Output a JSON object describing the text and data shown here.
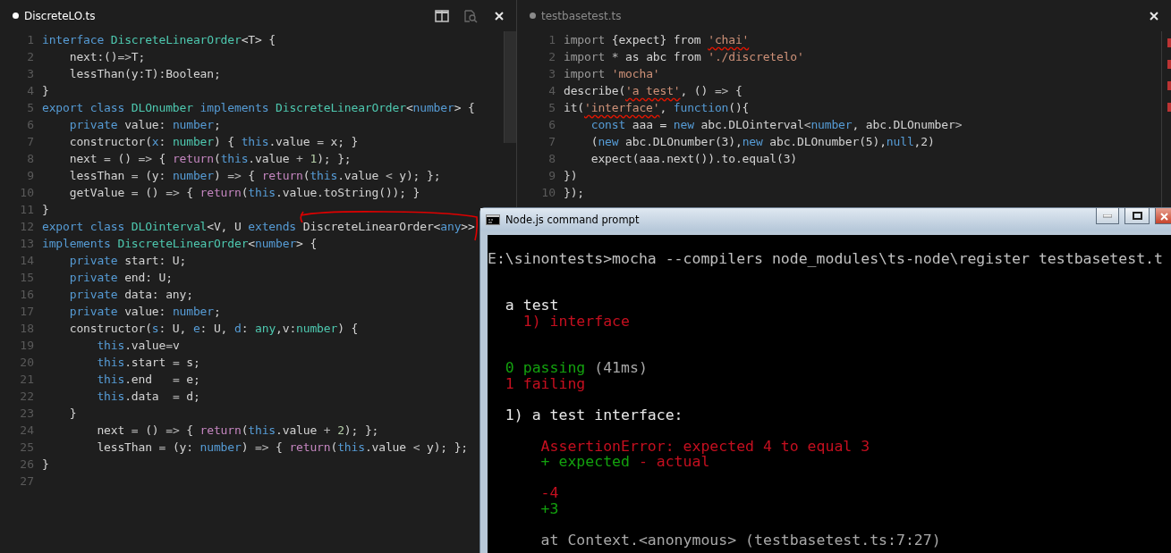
{
  "editors": [
    {
      "tab": {
        "title": "DiscreteLO.ts",
        "dirty": true,
        "active": true
      },
      "lines": [
        {
          "n": "1",
          "tokens": [
            {
              "kind": "kw",
              "text": "interface "
            },
            {
              "kind": "type",
              "text": "DiscreteLinearOrder"
            },
            {
              "kind": "txt",
              "text": "<T> {"
            }
          ]
        },
        {
          "n": "2",
          "tokens": [
            {
              "kind": "txt",
              "text": "    next:()"
            },
            {
              "kind": "op",
              "text": "=>"
            },
            {
              "kind": "txt",
              "text": "T;"
            }
          ]
        },
        {
          "n": "3",
          "tokens": [
            {
              "kind": "txt",
              "text": "    lessThan(y:T):Boolean;"
            }
          ]
        },
        {
          "n": "4",
          "tokens": [
            {
              "kind": "txt",
              "text": "}"
            }
          ]
        },
        {
          "n": "5",
          "tokens": [
            {
              "kind": "kw",
              "text": "export class "
            },
            {
              "kind": "type",
              "text": "DLOnumber "
            },
            {
              "kind": "kw",
              "text": "implements "
            },
            {
              "kind": "type",
              "text": "DiscreteLinearOrder"
            },
            {
              "kind": "txt",
              "text": "<"
            },
            {
              "kind": "kw",
              "text": "number"
            },
            {
              "kind": "txt",
              "text": "> {"
            }
          ]
        },
        {
          "n": "6",
          "tokens": [
            {
              "kind": "kw",
              "text": "    private "
            },
            {
              "kind": "txt",
              "text": "value: "
            },
            {
              "kind": "kw",
              "text": "number"
            },
            {
              "kind": "txt",
              "text": ";"
            }
          ]
        },
        {
          "n": "7",
          "tokens": [
            {
              "kind": "txt",
              "text": "    constructor("
            },
            {
              "kind": "kw",
              "text": "x"
            },
            {
              "kind": "txt",
              "text": ": "
            },
            {
              "kind": "type",
              "text": "number"
            },
            {
              "kind": "txt",
              "text": ") { "
            },
            {
              "kind": "kw",
              "text": "this"
            },
            {
              "kind": "txt",
              "text": ".value "
            },
            {
              "kind": "op",
              "text": "="
            },
            {
              "kind": "txt",
              "text": " x; }"
            }
          ]
        },
        {
          "n": "8",
          "tokens": [
            {
              "kind": "txt",
              "text": "    next "
            },
            {
              "kind": "op",
              "text": "="
            },
            {
              "kind": "txt",
              "text": " () "
            },
            {
              "kind": "op",
              "text": "=>"
            },
            {
              "kind": "txt",
              "text": " { "
            },
            {
              "kind": "ctl",
              "text": "return"
            },
            {
              "kind": "txt",
              "text": "("
            },
            {
              "kind": "kw",
              "text": "this"
            },
            {
              "kind": "txt",
              "text": ".value "
            },
            {
              "kind": "op",
              "text": "+ "
            },
            {
              "kind": "num",
              "text": "1"
            },
            {
              "kind": "txt",
              "text": "); };"
            }
          ]
        },
        {
          "n": "9",
          "tokens": [
            {
              "kind": "txt",
              "text": "    lessThan "
            },
            {
              "kind": "op",
              "text": "="
            },
            {
              "kind": "txt",
              "text": " (y: "
            },
            {
              "kind": "kw",
              "text": "number"
            },
            {
              "kind": "txt",
              "text": ") "
            },
            {
              "kind": "op",
              "text": "=>"
            },
            {
              "kind": "txt",
              "text": " { "
            },
            {
              "kind": "ctl",
              "text": "return"
            },
            {
              "kind": "txt",
              "text": "("
            },
            {
              "kind": "kw",
              "text": "this"
            },
            {
              "kind": "txt",
              "text": ".value "
            },
            {
              "kind": "op",
              "text": "<"
            },
            {
              "kind": "txt",
              "text": " y); };"
            }
          ]
        },
        {
          "n": "10",
          "tokens": [
            {
              "kind": "txt",
              "text": "    getValue "
            },
            {
              "kind": "op",
              "text": "="
            },
            {
              "kind": "txt",
              "text": " () "
            },
            {
              "kind": "op",
              "text": "=>"
            },
            {
              "kind": "txt",
              "text": " { "
            },
            {
              "kind": "ctl",
              "text": "return"
            },
            {
              "kind": "txt",
              "text": "("
            },
            {
              "kind": "kw",
              "text": "this"
            },
            {
              "kind": "txt",
              "text": ".value.toString()); }"
            }
          ]
        },
        {
          "n": "11",
          "tokens": [
            {
              "kind": "txt",
              "text": "}"
            }
          ]
        },
        {
          "n": "12",
          "tokens": [
            {
              "kind": "kw",
              "text": "export class "
            },
            {
              "kind": "type",
              "text": "DLOinterval"
            },
            {
              "kind": "txt",
              "text": "<V, U "
            },
            {
              "kind": "kw",
              "text": "extends "
            },
            {
              "kind": "txt",
              "text": "DiscreteLinearOrder<"
            },
            {
              "kind": "kw",
              "text": "any"
            },
            {
              "kind": "txt",
              "text": ">>"
            }
          ]
        },
        {
          "n": "13",
          "tokens": [
            {
              "kind": "kw",
              "text": "implements "
            },
            {
              "kind": "type",
              "text": "DiscreteLinearOrder"
            },
            {
              "kind": "txt",
              "text": "<"
            },
            {
              "kind": "kw",
              "text": "number"
            },
            {
              "kind": "txt",
              "text": "> {"
            }
          ]
        },
        {
          "n": "14",
          "tokens": [
            {
              "kind": "kw",
              "text": "    private "
            },
            {
              "kind": "txt",
              "text": "start: U;"
            }
          ]
        },
        {
          "n": "15",
          "tokens": [
            {
              "kind": "kw",
              "text": "    private "
            },
            {
              "kind": "txt",
              "text": "end: U;"
            }
          ]
        },
        {
          "n": "16",
          "tokens": [
            {
              "kind": "kw",
              "text": "    private "
            },
            {
              "kind": "txt",
              "text": "data: any;"
            }
          ]
        },
        {
          "n": "17",
          "tokens": [
            {
              "kind": "kw",
              "text": "    private "
            },
            {
              "kind": "txt",
              "text": "value: "
            },
            {
              "kind": "kw",
              "text": "number"
            },
            {
              "kind": "txt",
              "text": ";"
            }
          ]
        },
        {
          "n": "18",
          "tokens": [
            {
              "kind": "txt",
              "text": "    constructor("
            },
            {
              "kind": "kw",
              "text": "s"
            },
            {
              "kind": "txt",
              "text": ": U, "
            },
            {
              "kind": "kw",
              "text": "e"
            },
            {
              "kind": "txt",
              "text": ": U, "
            },
            {
              "kind": "kw",
              "text": "d"
            },
            {
              "kind": "txt",
              "text": ": "
            },
            {
              "kind": "type",
              "text": "any"
            },
            {
              "kind": "txt",
              "text": ",v:"
            },
            {
              "kind": "type",
              "text": "number"
            },
            {
              "kind": "txt",
              "text": ") {"
            }
          ]
        },
        {
          "n": "19",
          "tokens": [
            {
              "kind": "kw",
              "text": "        this"
            },
            {
              "kind": "txt",
              "text": ".value"
            },
            {
              "kind": "op",
              "text": "="
            },
            {
              "kind": "txt",
              "text": "v"
            }
          ]
        },
        {
          "n": "20",
          "tokens": [
            {
              "kind": "kw",
              "text": "        this"
            },
            {
              "kind": "txt",
              "text": ".start "
            },
            {
              "kind": "op",
              "text": "="
            },
            {
              "kind": "txt",
              "text": " s;"
            }
          ]
        },
        {
          "n": "21",
          "tokens": [
            {
              "kind": "kw",
              "text": "        this"
            },
            {
              "kind": "txt",
              "text": ".end   "
            },
            {
              "kind": "op",
              "text": "="
            },
            {
              "kind": "txt",
              "text": " e;"
            }
          ]
        },
        {
          "n": "22",
          "tokens": [
            {
              "kind": "kw",
              "text": "        this"
            },
            {
              "kind": "txt",
              "text": ".data  "
            },
            {
              "kind": "op",
              "text": "="
            },
            {
              "kind": "txt",
              "text": " d;"
            }
          ]
        },
        {
          "n": "23",
          "tokens": [
            {
              "kind": "txt",
              "text": "    }"
            }
          ]
        },
        {
          "n": "24",
          "tokens": [
            {
              "kind": "txt",
              "text": "        next "
            },
            {
              "kind": "op",
              "text": "="
            },
            {
              "kind": "txt",
              "text": " () "
            },
            {
              "kind": "op",
              "text": "=>"
            },
            {
              "kind": "txt",
              "text": " { "
            },
            {
              "kind": "ctl",
              "text": "return"
            },
            {
              "kind": "txt",
              "text": "("
            },
            {
              "kind": "kw",
              "text": "this"
            },
            {
              "kind": "txt",
              "text": ".value "
            },
            {
              "kind": "op",
              "text": "+ "
            },
            {
              "kind": "num",
              "text": "2"
            },
            {
              "kind": "txt",
              "text": "); };"
            }
          ]
        },
        {
          "n": "25",
          "tokens": [
            {
              "kind": "txt",
              "text": "        lessThan "
            },
            {
              "kind": "op",
              "text": "="
            },
            {
              "kind": "txt",
              "text": " (y: "
            },
            {
              "kind": "kw",
              "text": "number"
            },
            {
              "kind": "txt",
              "text": ") "
            },
            {
              "kind": "op",
              "text": "=>"
            },
            {
              "kind": "txt",
              "text": " { "
            },
            {
              "kind": "ctl",
              "text": "return"
            },
            {
              "kind": "txt",
              "text": "("
            },
            {
              "kind": "kw",
              "text": "this"
            },
            {
              "kind": "txt",
              "text": ".value "
            },
            {
              "kind": "op",
              "text": "<"
            },
            {
              "kind": "txt",
              "text": " y); };"
            }
          ]
        },
        {
          "n": "26",
          "tokens": [
            {
              "kind": "txt",
              "text": "}"
            }
          ]
        },
        {
          "n": "27"
        }
      ]
    },
    {
      "tab": {
        "title": "testbasetest.ts",
        "dirty": true,
        "active": false
      },
      "lines": [
        {
          "n": "1",
          "tokens": [
            {
              "kind": "dim",
              "text": "import "
            },
            {
              "kind": "txt",
              "text": "{expect} from "
            },
            {
              "kind": "err",
              "text": "'chai'"
            }
          ]
        },
        {
          "n": "2",
          "tokens": [
            {
              "kind": "dim",
              "text": "import "
            },
            {
              "kind": "op",
              "text": "* "
            },
            {
              "kind": "txt",
              "text": "as abc from "
            },
            {
              "kind": "str",
              "text": "'./discretelo'"
            }
          ]
        },
        {
          "n": "3",
          "tokens": [
            {
              "kind": "dim",
              "text": "import "
            },
            {
              "kind": "str",
              "text": "'mocha'"
            }
          ]
        },
        {
          "n": "4",
          "tokens": [
            {
              "kind": "txt",
              "text": "describe("
            },
            {
              "kind": "err",
              "text": "'a test'"
            },
            {
              "kind": "txt",
              "text": ", () "
            },
            {
              "kind": "op",
              "text": "=>"
            },
            {
              "kind": "txt",
              "text": " {"
            }
          ]
        },
        {
          "n": "5",
          "tokens": [
            {
              "kind": "txt",
              "text": "it("
            },
            {
              "kind": "err",
              "text": "'interface'"
            },
            {
              "kind": "txt",
              "text": ", "
            },
            {
              "kind": "kw",
              "text": "function"
            },
            {
              "kind": "txt",
              "text": "(){"
            }
          ]
        },
        {
          "n": "6",
          "tokens": [
            {
              "kind": "kw",
              "text": "    const "
            },
            {
              "kind": "txt",
              "text": "aaa = "
            },
            {
              "kind": "kw",
              "text": "new "
            },
            {
              "kind": "txt",
              "text": "abc.DLOinterval"
            },
            {
              "kind": "op",
              "text": "<"
            },
            {
              "kind": "kw",
              "text": "number"
            },
            {
              "kind": "txt",
              "text": ", abc.DLOnumber"
            },
            {
              "kind": "op",
              "text": ">"
            }
          ]
        },
        {
          "n": "7",
          "tokens": [
            {
              "kind": "txt",
              "text": "    ("
            },
            {
              "kind": "kw",
              "text": "new "
            },
            {
              "kind": "txt",
              "text": "abc.DLOnumber(3),"
            },
            {
              "kind": "kw",
              "text": "new "
            },
            {
              "kind": "txt",
              "text": "abc.DLOnumber(5),"
            },
            {
              "kind": "kw",
              "text": "null"
            },
            {
              "kind": "txt",
              "text": ",2)"
            }
          ]
        },
        {
          "n": "8",
          "tokens": [
            {
              "kind": "txt",
              "text": "    expect(aaa.next()).to.equal(3)"
            }
          ]
        },
        {
          "n": "9",
          "tokens": [
            {
              "kind": "txt",
              "text": "})"
            }
          ]
        },
        {
          "n": "10",
          "tokens": [
            {
              "kind": "txt",
              "text": "});"
            }
          ]
        }
      ]
    }
  ],
  "console": {
    "title": "Node.js command prompt",
    "lines": [
      {
        "kind": "blank"
      },
      {
        "kind": "text",
        "spans": [
          {
            "kind": "plain",
            "text": "E:\\sinontests>mocha --compilers node_modules\\ts-node\\register testbasetest.t"
          }
        ]
      },
      {
        "kind": "blank"
      },
      {
        "kind": "blank"
      },
      {
        "kind": "text",
        "spans": [
          {
            "kind": "bright",
            "text": "  a test"
          }
        ]
      },
      {
        "kind": "text",
        "spans": [
          {
            "kind": "fail",
            "text": "    1) interface"
          }
        ]
      },
      {
        "kind": "blank"
      },
      {
        "kind": "blank"
      },
      {
        "kind": "text",
        "spans": [
          {
            "kind": "pass",
            "text": "  0 passing"
          },
          {
            "kind": "dim",
            "text": " (41ms)"
          }
        ]
      },
      {
        "kind": "text",
        "spans": [
          {
            "kind": "fail",
            "text": "  1 failing"
          }
        ]
      },
      {
        "kind": "blank"
      },
      {
        "kind": "text",
        "spans": [
          {
            "kind": "bright",
            "text": "  1) a test interface:"
          }
        ]
      },
      {
        "kind": "blank"
      },
      {
        "kind": "text",
        "spans": [
          {
            "kind": "fail",
            "text": "      AssertionError: expected 4 to equal 3"
          }
        ]
      },
      {
        "kind": "text",
        "spans": [
          {
            "kind": "pass",
            "text": "      + expected"
          },
          {
            "kind": "fail",
            "text": " - actual"
          }
        ]
      },
      {
        "kind": "blank"
      },
      {
        "kind": "text",
        "spans": [
          {
            "kind": "fail",
            "text": "      -4"
          }
        ]
      },
      {
        "kind": "text",
        "spans": [
          {
            "kind": "pass",
            "text": "      +3"
          }
        ]
      },
      {
        "kind": "blank"
      },
      {
        "kind": "text",
        "spans": [
          {
            "kind": "dim",
            "text": "      at Context.<anonymous> (testbasetest.ts:7:27)"
          }
        ]
      }
    ]
  }
}
